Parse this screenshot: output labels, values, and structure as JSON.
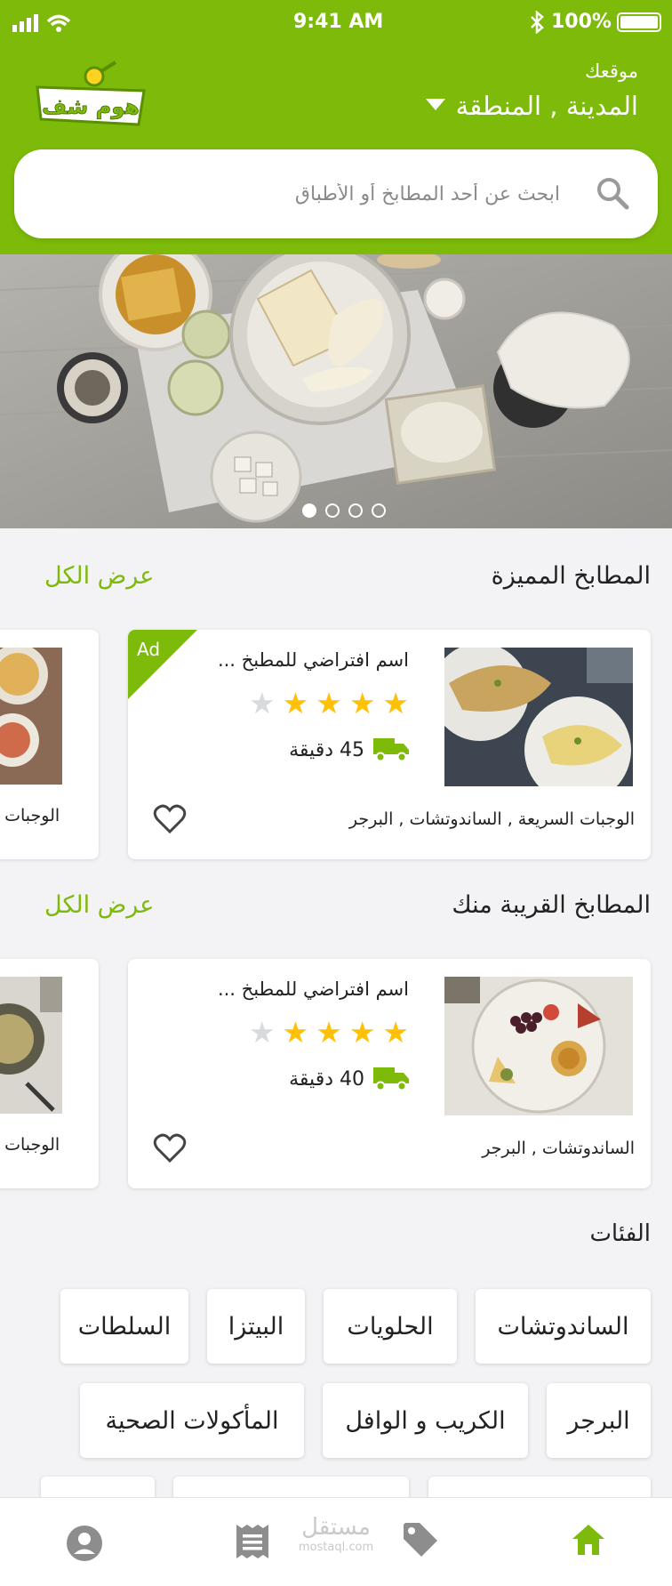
{
  "status_bar": {
    "time": "9:41 AM",
    "battery": "100%"
  },
  "brand": {
    "logo_text": "هوم شف",
    "accent": "#7dba09"
  },
  "location": {
    "label": "موقعك",
    "value": "المدينة , المنطقة"
  },
  "search": {
    "placeholder": "ابحث عن أحد المطابخ أو الأطباق"
  },
  "hero": {
    "slides": 4,
    "active": 0
  },
  "featured": {
    "title": "المطابخ المميزة",
    "view_all": "عرض الكل",
    "card": {
      "name": "اسم افتراضي للمطبخ ...",
      "rating": 4,
      "max_rating": 5,
      "time": "45 دقيقة",
      "tags": "الوجبات السريعة , الساندوتشات , البرجر",
      "badge": "Ad"
    },
    "peek_tags": "الوجبات ال"
  },
  "nearby": {
    "title": "المطابخ القريبة منك",
    "view_all": "عرض الكل",
    "card": {
      "name": "اسم افتراضي للمطبخ ...",
      "rating": 4,
      "max_rating": 5,
      "time": "40 دقيقة",
      "tags": "الساندوتشات , البرجر"
    },
    "peek_tags": "الوجبات ال"
  },
  "categories": {
    "title": "الفئات",
    "row1": [
      "الساندوتشات",
      "الحلويات",
      "البيتزا",
      "السلطات"
    ],
    "row2": [
      "البرجر",
      "الكريب و الوافل",
      "المأكولات الصحية"
    ]
  },
  "tabbar": {
    "active": "home",
    "watermark": "مستقل",
    "watermark_sub": "mostaql.com"
  }
}
